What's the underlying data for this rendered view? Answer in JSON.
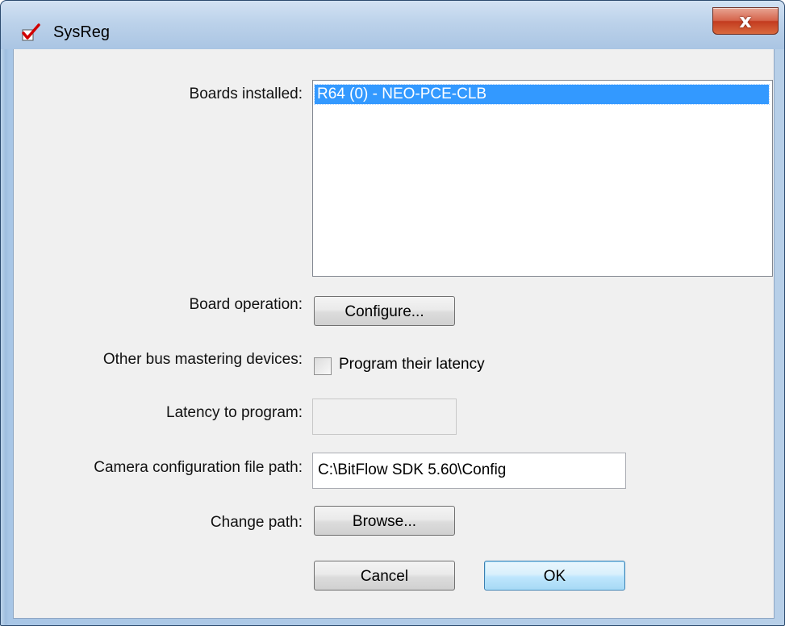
{
  "window": {
    "title": "SysReg",
    "close_glyph": "x",
    "app_icon": "red-checkmark-icon"
  },
  "labels": {
    "boards_installed": "Boards installed:",
    "board_operation": "Board operation:",
    "other_bus": "Other bus mastering devices:",
    "latency": "Latency to program:",
    "camera_path": "Camera configuration file path:",
    "change_path": "Change path:"
  },
  "boards_list": {
    "items": [
      "R64 (0) - NEO-PCE-CLB"
    ],
    "selected": "R64 (0) - NEO-PCE-CLB"
  },
  "buttons": {
    "configure": "Configure...",
    "browse": "Browse...",
    "cancel": "Cancel",
    "ok": "OK"
  },
  "checkbox": {
    "label": "Program their latency",
    "checked": false
  },
  "fields": {
    "latency_value": "",
    "camera_path_value": "C:\\BitFlow SDK 5.60\\Config"
  },
  "colors": {
    "selection": "#3399ff",
    "dialog_bg": "#f0f0f0",
    "close_button": "#c8452a"
  }
}
